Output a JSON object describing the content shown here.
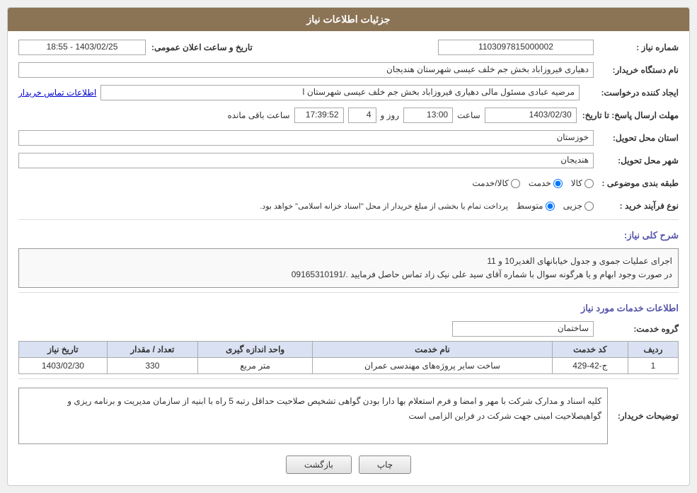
{
  "header": {
    "title": "جزئیات اطلاعات نیاز"
  },
  "fields": {
    "need_number_label": "شماره نیاز :",
    "need_number_value": "1103097815000002",
    "buyer_org_label": "نام دستگاه خریدار:",
    "buyer_org_value": "دهیاری فیروزاباد بخش جم خلف عیسی شهرستان هندیجان",
    "creator_label": "ایجاد کننده درخواست:",
    "creator_value": "مرضیه عبادی مسئول مالی دهیاری فیروزاباد بخش جم خلف عیسی شهرستان ا",
    "creator_link": "اطلاعات تماس خریدار",
    "response_deadline_label": "مهلت ارسال پاسخ: تا تاریخ:",
    "deadline_date": "1403/02/30",
    "deadline_time_label": "ساعت",
    "deadline_time": "13:00",
    "deadline_day_label": "روز و",
    "deadline_days": "4",
    "deadline_remain_label": "ساعت باقی مانده",
    "deadline_remain": "17:39:52",
    "province_label": "استان محل تحویل:",
    "province_value": "خوزستان",
    "city_label": "شهر محل تحویل:",
    "city_value": "هندیجان",
    "category_label": "طبقه بندی موضوعی :",
    "category_options": [
      {
        "label": "کالا",
        "value": "kala",
        "checked": false
      },
      {
        "label": "خدمت",
        "value": "khedmat",
        "checked": true
      },
      {
        "label": "کالا/خدمت",
        "value": "kala_khedmat",
        "checked": false
      }
    ],
    "purchase_type_label": "نوع فرآیند خرید :",
    "purchase_type_options": [
      {
        "label": "جزیی",
        "value": "jozi",
        "checked": false
      },
      {
        "label": "متوسط",
        "value": "motevaset",
        "checked": true
      }
    ],
    "purchase_type_note": "پرداخت تمام یا بخشی از مبلغ خریدار از محل \"اسناد خزانه اسلامی\" خواهد بود.",
    "announcement_label": "تاریخ و ساعت اعلان عمومی:",
    "announcement_value": "1403/02/25 - 18:55",
    "description_section_label": "شرح کلی نیاز:",
    "description_line1": "اجرای عملیات جموی و جدول خیابانهای الغدیر10 و 11",
    "description_line2": "در صورت وجود ابهام و یا هرگونه سوال با شماره  آقای سید علی نیک زاد تماس حاصل فرمایید ./09165310191",
    "services_section_label": "اطلاعات خدمات مورد نیاز",
    "service_group_label": "گروه خدمت:",
    "service_group_value": "ساختمان",
    "table_headers": [
      "ردیف",
      "کد خدمت",
      "نام خدمت",
      "واحد اندازه گیری",
      "تعداد / مقدار",
      "تاریخ نیاز"
    ],
    "table_rows": [
      {
        "row": "1",
        "code": "ج-42-429",
        "name": "ساخت سایر پروژه‌های مهندسی عمران",
        "unit": "متر مربع",
        "qty": "330",
        "date": "1403/02/30"
      }
    ],
    "notes_label": "توضیحات خریدار:",
    "notes_text": "کلیه اسناد و مدارک شرکت با مهر و امضا و فرم استعلام بها دارا بودن گواهی تشخیص صلاحیت حداقل رتبه 5 راه با ابنیه از سازمان مدیریت و برنامه ریزی و گواهیصلاحیت امینی جهت شرکت در فراین الزامی است",
    "btn_back": "بازگشت",
    "btn_print": "چاپ"
  }
}
